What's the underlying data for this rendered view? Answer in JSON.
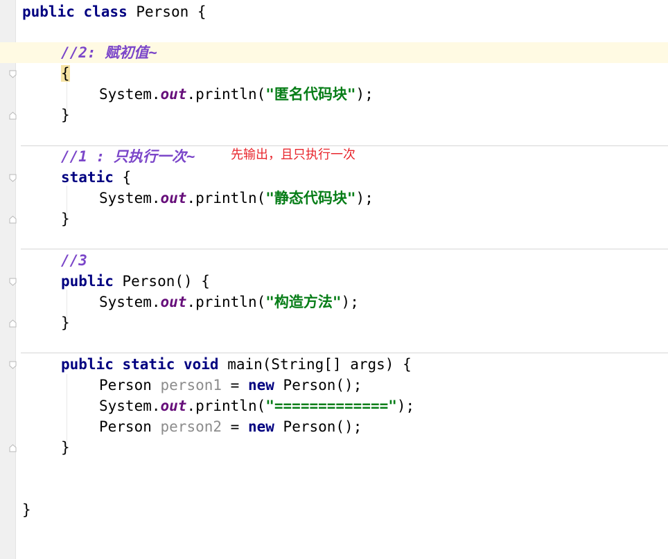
{
  "code": {
    "line1": {
      "kw": "public class ",
      "text": "Person {"
    },
    "comment_init": "//2: 赋初值~",
    "brace_open_1": "{",
    "sys_1": "System.",
    "out_1": "out",
    "println_1": ".println(",
    "str_1": "\"匿名代码块\"",
    "end_1": ");",
    "brace_close_1": "}",
    "comment_static": "//1 : 只执行一次~",
    "static_kw": "static",
    "static_brace": " {",
    "sys_2": "System.",
    "out_2": "out",
    "println_2": ".println(",
    "str_2": "\"静态代码块\"",
    "end_2": ");",
    "brace_close_2": "}",
    "comment_ctor": "//3",
    "ctor_kw": "public",
    "ctor_rest": " Person() {",
    "sys_3": "System.",
    "out_3": "out",
    "println_3": ".println(",
    "str_3": "\"构造方法\"",
    "end_3": ");",
    "brace_close_3": "}",
    "main_kw": "public static void",
    "main_rest": " main(String[] args) {",
    "p1_type": "Person ",
    "p1_var": "person1",
    "p1_eq": " = ",
    "p1_new": "new",
    "p1_rest": " Person();",
    "sys_4": "System.",
    "out_4": "out",
    "println_4": ".println(",
    "str_4": "\"=============\"",
    "end_4": ");",
    "p2_type": "Person ",
    "p2_var": "person2",
    "p2_eq": " = ",
    "p2_new": "new",
    "p2_rest": " Person();",
    "brace_close_main": "}",
    "brace_close_class": "}"
  },
  "annotation": "先输出，且只执行一次"
}
